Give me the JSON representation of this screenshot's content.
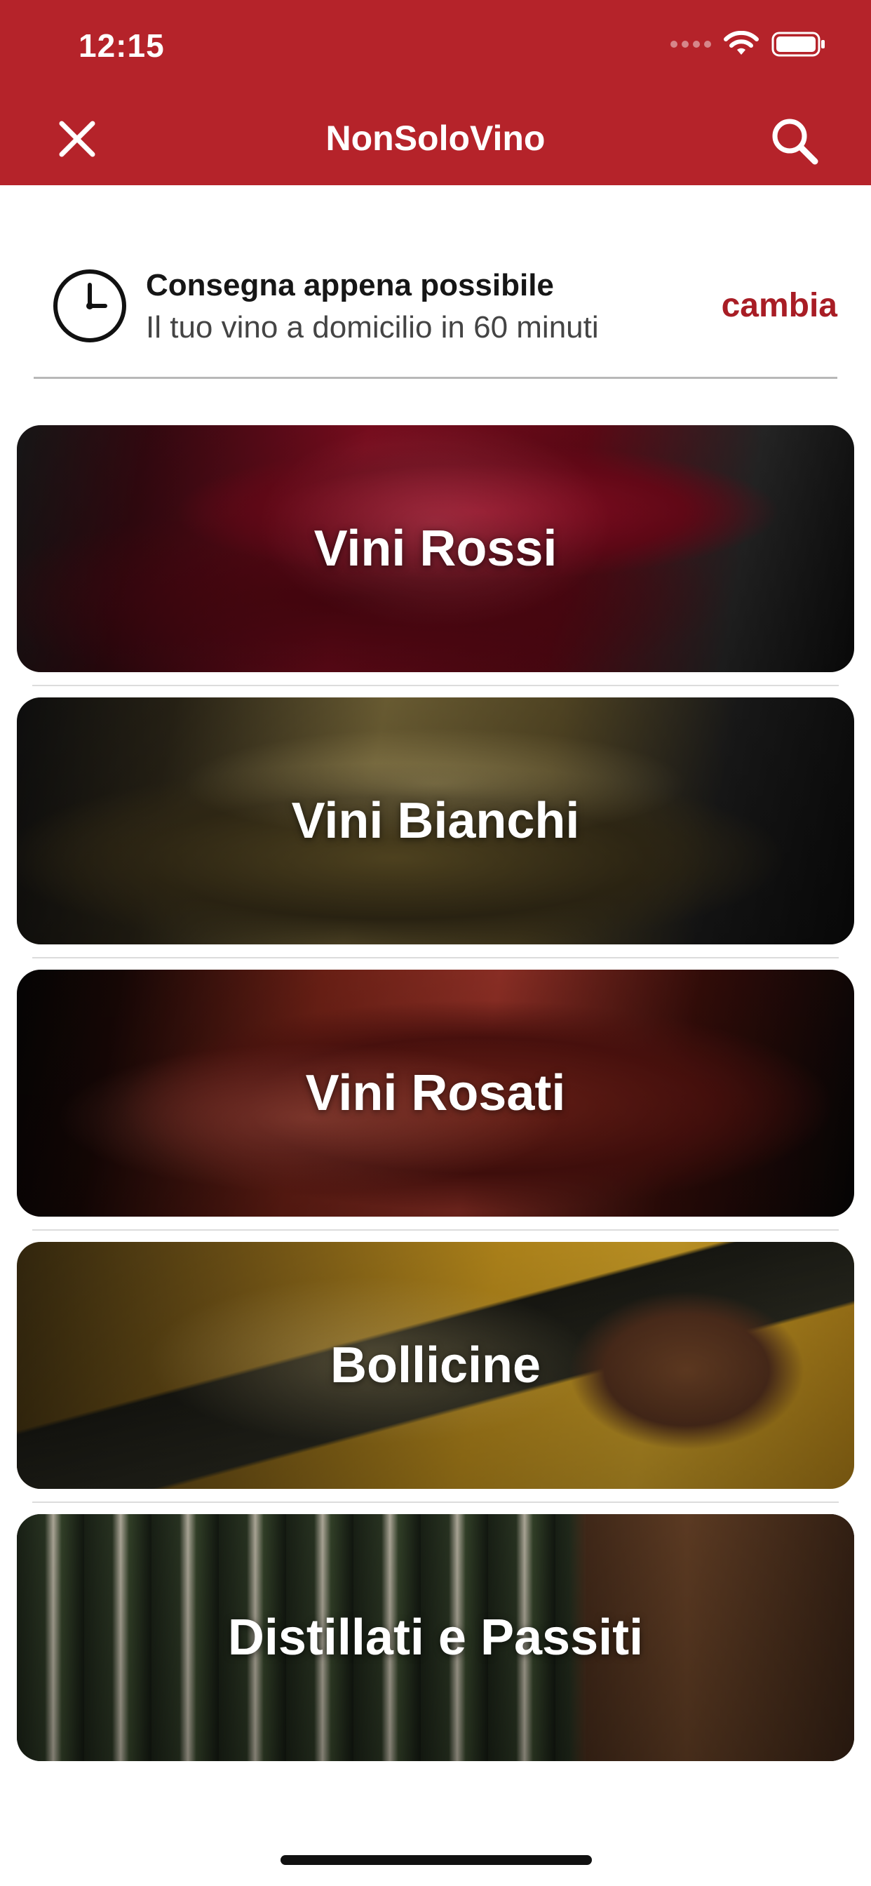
{
  "status_bar": {
    "time": "12:15"
  },
  "nav": {
    "title": "NonSoloVino",
    "close_icon": "close-icon",
    "search_icon": "search-icon"
  },
  "delivery": {
    "title": "Consegna appena possibile",
    "subtitle": "Il tuo vino a domicilio in 60 minuti",
    "change_label": "cambia",
    "icon": "clock-icon"
  },
  "categories": [
    {
      "label": "Vini Rossi"
    },
    {
      "label": "Vini Bianchi"
    },
    {
      "label": "Vini Rosati"
    },
    {
      "label": "Bollicine"
    },
    {
      "label": "Distillati e Passiti"
    }
  ],
  "colors": {
    "brand": "#b5232a",
    "accent_text": "#a81d25"
  }
}
